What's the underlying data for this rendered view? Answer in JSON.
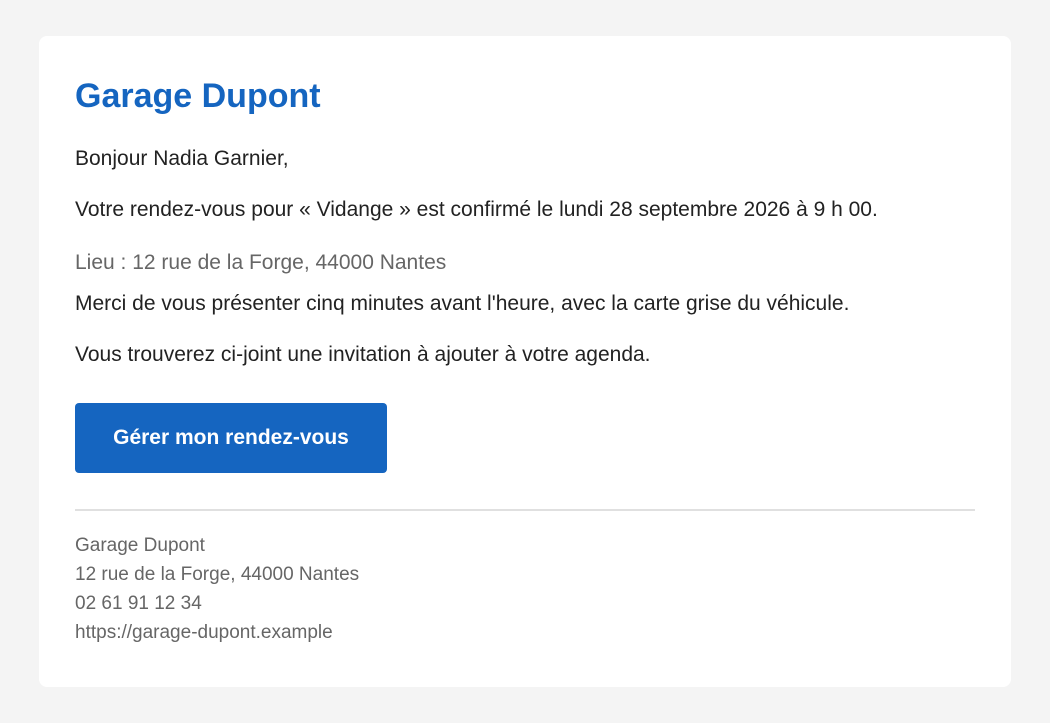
{
  "email": {
    "brand_name": "Garage Dupont",
    "greeting": "Bonjour Nadia Garnier,",
    "confirmation": "Votre rendez-vous pour « Vidange » est confirmé le lundi 28 septembre 2026 à 9 h 00.",
    "location": "Lieu : 12 rue de la Forge, 44000 Nantes",
    "instructions": "Merci de vous présenter cinq minutes avant l'heure, avec la carte grise du véhicule.",
    "attachment_note": "Vous trouverez ci-joint une invitation à ajouter à votre agenda.",
    "manage_button_label": "Gérer mon rendez-vous"
  },
  "footer": {
    "name": "Garage Dupont",
    "address": "12 rue de la Forge, 44000 Nantes",
    "phone": "02 61 91 12 34",
    "website": "https://garage-dupont.example"
  },
  "colors": {
    "brand": "#1565c0",
    "background": "#f4f4f4",
    "muted_text": "#666666"
  }
}
